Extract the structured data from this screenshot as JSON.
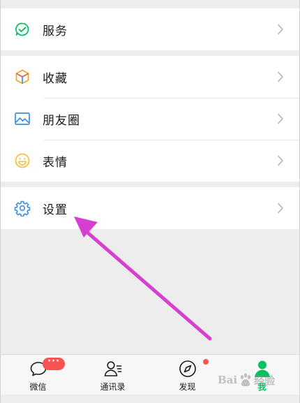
{
  "menu": {
    "group1": [
      {
        "label": "服务",
        "icon": "service-icon"
      }
    ],
    "group2": [
      {
        "label": "收藏",
        "icon": "favorites-icon"
      },
      {
        "label": "朋友圈",
        "icon": "moments-icon"
      },
      {
        "label": "表情",
        "icon": "stickers-icon"
      }
    ],
    "group3": [
      {
        "label": "设置",
        "icon": "settings-icon"
      }
    ]
  },
  "tabbar": {
    "tabs": [
      {
        "label": "微信",
        "icon": "chats-icon",
        "badge": "···"
      },
      {
        "label": "通讯录",
        "icon": "contacts-icon"
      },
      {
        "label": "发现",
        "icon": "discover-icon"
      },
      {
        "label": "我",
        "icon": "me-icon",
        "active": true
      }
    ]
  },
  "watermark": {
    "text_before": "Bai",
    "text_after": "经验"
  },
  "colors": {
    "accent": "#07c160",
    "badge": "#fa5151",
    "annotation_arrow": "#d63fcf",
    "background": "#ededed"
  }
}
